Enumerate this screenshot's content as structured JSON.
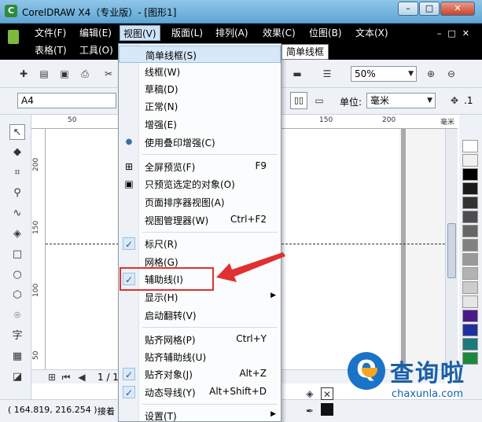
{
  "window": {
    "title": "CorelDRAW X4（专业版）- [图形1]",
    "logo": "CorelDRAW-logo"
  },
  "menubar": {
    "row1": [
      "文件(F)",
      "编辑(E)",
      "视图(V)",
      "版面(L)",
      "排列(A)",
      "效果(C)",
      "位图(B)",
      "文本(X)"
    ],
    "row2": [
      "表格(T)",
      "工具(O)"
    ],
    "active": "视图(V)"
  },
  "toolbar": {
    "zoom_value": "50%",
    "icons": [
      "new-icon",
      "open-icon",
      "save-icon",
      "print-icon",
      "cut-icon",
      "zoom-in-icon",
      "zoom-out-icon"
    ]
  },
  "propbar": {
    "page_size": "A4",
    "unit_label": "单位:",
    "unit_value": "毫米",
    "nudge_value": ".1"
  },
  "ruler": {
    "top_labels": [
      "50",
      "150",
      "200"
    ],
    "top_unit": "毫米",
    "left_labels": [
      "200",
      "150",
      "100",
      "50"
    ]
  },
  "page_nav": {
    "page_text": "1 / 1"
  },
  "statusbar": {
    "coords": "( 164.819, 216.254 )",
    "hint": "接着"
  },
  "view_menu": {
    "items": [
      {
        "label": "简单线框(S)",
        "shortcut": "",
        "state": "highlight"
      },
      {
        "label": "线框(W)",
        "shortcut": ""
      },
      {
        "label": "草稿(D)",
        "shortcut": ""
      },
      {
        "label": "正常(N)",
        "shortcut": ""
      },
      {
        "label": "增强(E)",
        "shortcut": ""
      },
      {
        "label": "使用叠印增强(C)",
        "shortcut": "",
        "icon": "radio-dot-icon"
      },
      {
        "label": "全屏预览(F)",
        "shortcut": "F9",
        "icon": "fullscreen-preview-icon"
      },
      {
        "label": "只预览选定的对象(O)",
        "shortcut": "",
        "icon": "preview-selected-icon"
      },
      {
        "label": "页面排序器视图(A)",
        "shortcut": ""
      },
      {
        "label": "视图管理器(W)",
        "shortcut": "Ctrl+F2"
      },
      {
        "label": "标尺(R)",
        "shortcut": "",
        "checked": true
      },
      {
        "label": "网格(G)",
        "shortcut": ""
      },
      {
        "label": "辅助线(I)",
        "shortcut": "",
        "checked": true
      },
      {
        "label": "显示(H)",
        "shortcut": "",
        "submenu": true
      },
      {
        "label": "启动翻转(V)",
        "shortcut": ""
      },
      {
        "label": "贴齐网格(P)",
        "shortcut": "Ctrl+Y"
      },
      {
        "label": "贴齐辅助线(U)",
        "shortcut": ""
      },
      {
        "label": "贴齐对象(J)",
        "shortcut": "Alt+Z",
        "checked": true
      },
      {
        "label": "动态导线(Y)",
        "shortcut": "Alt+Shift+D",
        "checked": true
      },
      {
        "label": "设置(T)",
        "shortcut": "",
        "submenu": true
      }
    ]
  },
  "tooltip": "简单线框",
  "palette_colors": [
    "#ffffff",
    "#f0f0f0",
    "#000000",
    "#1a1a1a",
    "#333333",
    "#4d4d4d",
    "#666666",
    "#808080",
    "#999999",
    "#b3b3b3",
    "#cccccc",
    "#e6e6e6",
    "#4b1a8a",
    "#1e2fa0",
    "#1c7a7a",
    "#1a8a3a"
  ],
  "annotation": {
    "color": "#e03030"
  },
  "watermark": {
    "text": "查询啦",
    "sub": "chaxunla.com",
    "brand_color": "#1a73c7",
    "accent_color": "#f5a623"
  }
}
